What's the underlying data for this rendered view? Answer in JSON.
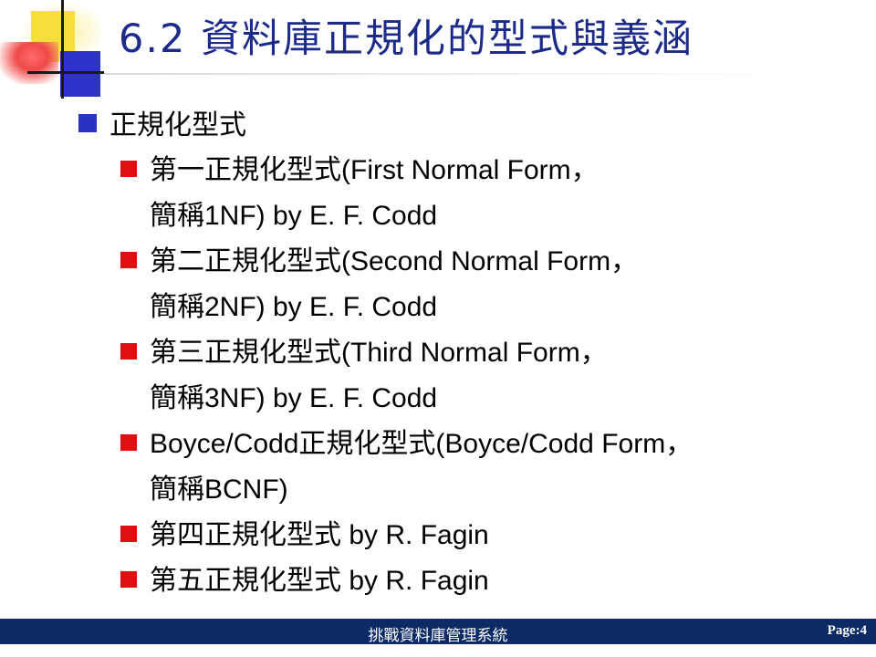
{
  "slide": {
    "title": "6.2 資料庫正規化的型式與義涵",
    "heading": "正規化型式",
    "items": [
      {
        "line1": "第一正規化型式(First Normal Form，",
        "line2": "簡稱1NF) by E. F. Codd"
      },
      {
        "line1": "第二正規化型式(Second Normal Form，",
        "line2": "簡稱2NF) by E. F. Codd"
      },
      {
        "line1": "第三正規化型式(Third Normal Form，",
        "line2": "簡稱3NF) by E. F. Codd"
      },
      {
        "line1": "Boyce/Codd正規化型式(Boyce/Codd Form，",
        "line2": "簡稱BCNF)"
      },
      {
        "line1": "第四正規化型式 by R. Fagin",
        "line2": ""
      },
      {
        "line1": "第五正規化型式 by R. Fagin",
        "line2": ""
      }
    ]
  },
  "footer": {
    "center": "挑戰資料庫管理系統",
    "page": "Page:4"
  },
  "colors": {
    "title": "#1c2a8a",
    "bullet_level1": "#2b33c7",
    "bullet_level2": "#e01010",
    "footer_bg": "#0b2a66"
  }
}
